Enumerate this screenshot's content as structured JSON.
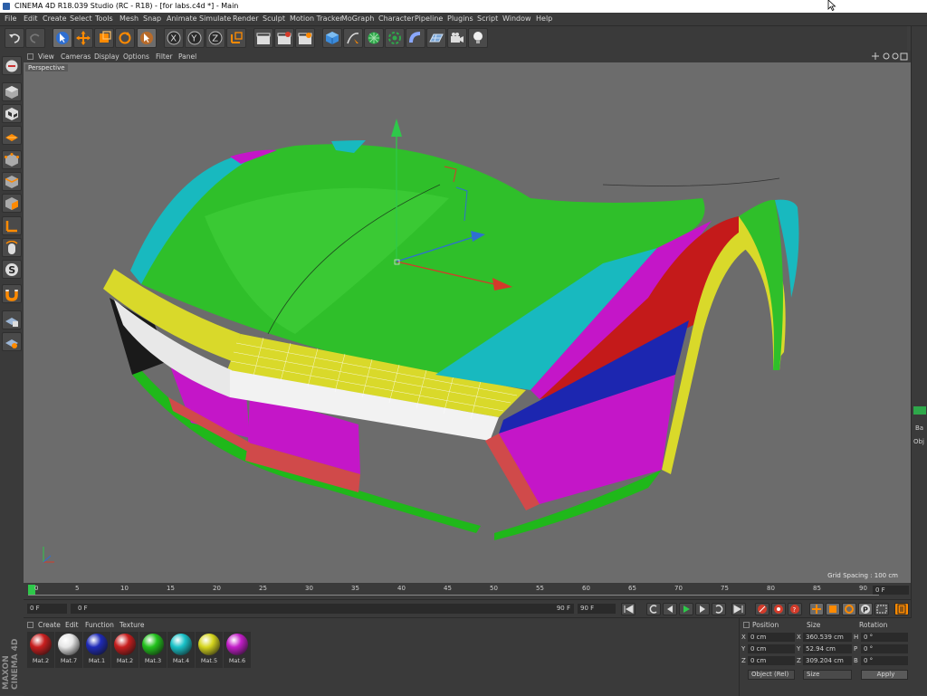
{
  "window": {
    "title": "CINEMA 4D R18.039 Studio (RC - R18) - [for labs.c4d *] - Main"
  },
  "menubar": [
    "File",
    "Edit",
    "Create",
    "Select",
    "Tools",
    "Mesh",
    "Snap",
    "Animate",
    "Simulate",
    "Render",
    "Sculpt",
    "Motion Tracker",
    "MoGraph",
    "Character",
    "Pipeline",
    "Plugins",
    "Script",
    "Window",
    "Help"
  ],
  "viewport": {
    "menu": [
      "View",
      "Cameras",
      "Display",
      "Options",
      "Filter",
      "Panel"
    ],
    "label": "Perspective",
    "grid_spacing": "Grid Spacing : 100 cm"
  },
  "timeline": {
    "ticks": [
      "0",
      "5",
      "10",
      "15",
      "20",
      "25",
      "30",
      "35",
      "40",
      "45",
      "50",
      "55",
      "60",
      "65",
      "70",
      "75",
      "80",
      "85",
      "90"
    ],
    "current_frame": "0 F"
  },
  "playback": {
    "start": "0 F",
    "min": "0 F",
    "max": "90 F",
    "end": "90 F"
  },
  "materials": {
    "menu": [
      "Create",
      "Edit",
      "Function",
      "Texture"
    ],
    "items": [
      {
        "name": "Mat.2",
        "color": "#c81e1e"
      },
      {
        "name": "Mat.7",
        "color": "#e6e6e6"
      },
      {
        "name": "Mat.1",
        "color": "#1f2bb8"
      },
      {
        "name": "Mat.2",
        "color": "#c81e1e"
      },
      {
        "name": "Mat.3",
        "color": "#22c21c"
      },
      {
        "name": "Mat.4",
        "color": "#19c2c8"
      },
      {
        "name": "Mat.5",
        "color": "#d5d51e"
      },
      {
        "name": "Mat.6",
        "color": "#c21ec8"
      }
    ]
  },
  "logo": "MAXON CINEMA 4D",
  "coordinates": {
    "headers": {
      "position": "Position",
      "size": "Size",
      "rotation": "Rotation"
    },
    "rows": [
      {
        "axis": "X",
        "position": "0 cm",
        "size_axis": "X",
        "size": "360.539 cm",
        "rot_axis": "H",
        "rotation": "0 °"
      },
      {
        "axis": "Y",
        "position": "0 cm",
        "size_axis": "Y",
        "size": "52.94 cm",
        "rot_axis": "P",
        "rotation": "0 °"
      },
      {
        "axis": "Z",
        "position": "0 cm",
        "size_axis": "Z",
        "size": "309.204 cm",
        "rot_axis": "B",
        "rotation": "0 °"
      }
    ],
    "mode_dropdown": "Object (Rel)",
    "size_dropdown": "Size",
    "apply_label": "Apply"
  },
  "colors": {
    "viewport_bg": "#6c6c6c",
    "panel_bg": "#3a3a3a",
    "accent_active": "#ff8a00"
  },
  "right_strip_labels": {
    "tab": "Ba",
    "label": "Obj"
  }
}
